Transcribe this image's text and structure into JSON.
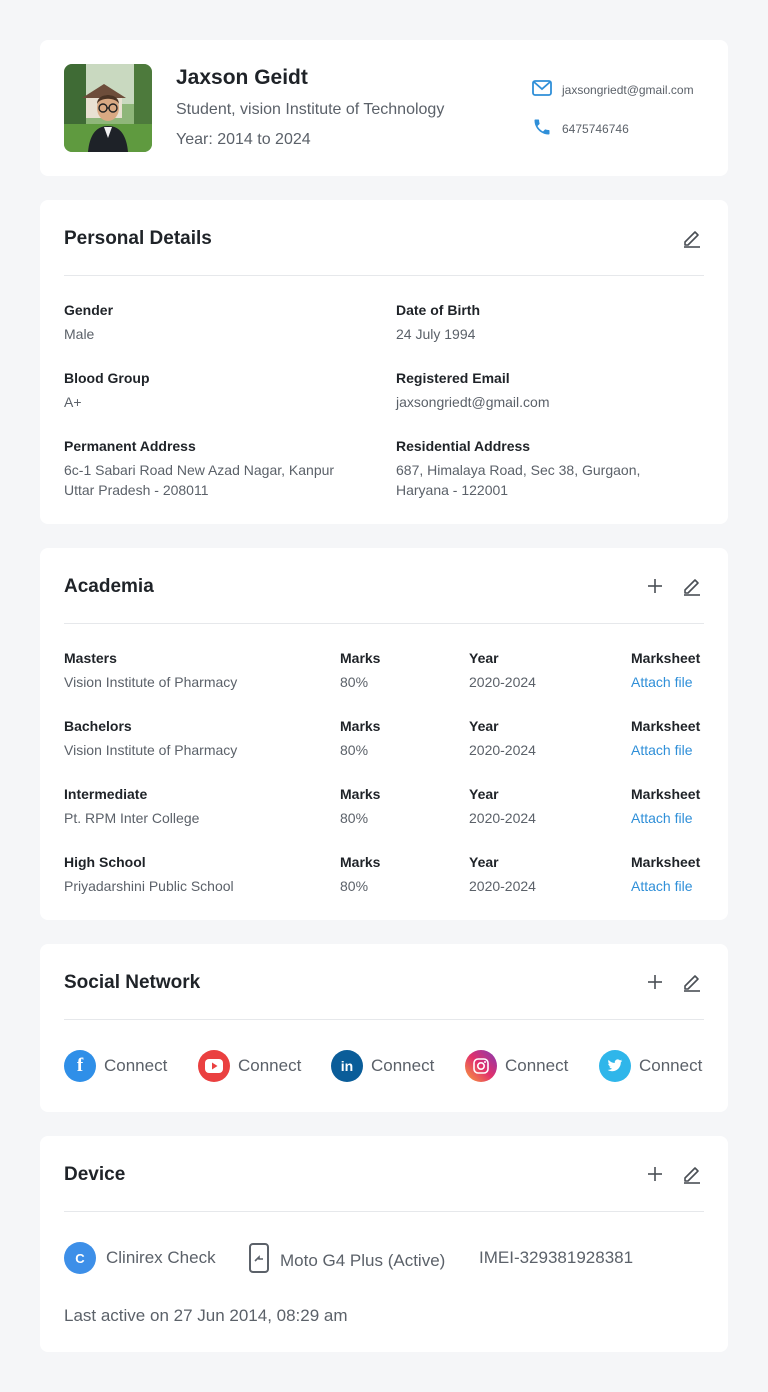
{
  "profile": {
    "name": "Jaxson Geidt",
    "role": "Student, vision Institute of Technology",
    "year": "Year: 2014 to 2024",
    "email": "jaxsongriedt@gmail.com",
    "phone": "6475746746"
  },
  "personal": {
    "title": "Personal Details",
    "fields": [
      {
        "label": "Gender",
        "value": "Male"
      },
      {
        "label": "Date of Birth",
        "value": "24 July 1994"
      },
      {
        "label": "Blood Group",
        "value": "A+"
      },
      {
        "label": "Registered Email",
        "value": "jaxsongriedt@gmail.com"
      },
      {
        "label": "Permanent Address",
        "value": "6c-1 Sabari Road New Azad Nagar, Kanpur",
        "value2": "Uttar Pradesh - 208011"
      },
      {
        "label": "Residential Address",
        "value": "687, Himalaya Road, Sec 38, Gurgaon,",
        "value2": "Haryana - 122001"
      }
    ]
  },
  "academia": {
    "title": "Academia",
    "rows": [
      {
        "level": "Masters",
        "institute": "Vision Institute of Pharmacy",
        "marks_label": "Marks",
        "marks": "80%",
        "year_label": "Year",
        "year": "2020-2024",
        "sheet_label": "Marksheet",
        "attach": "Attach file"
      },
      {
        "level": "Bachelors",
        "institute": "Vision Institute of Pharmacy",
        "marks_label": "Marks",
        "marks": "80%",
        "year_label": "Year",
        "year": "2020-2024",
        "sheet_label": "Marksheet",
        "attach": "Attach file"
      },
      {
        "level": "Intermediate",
        "institute": "Pt. RPM Inter College",
        "marks_label": "Marks",
        "marks": "80%",
        "year_label": "Year",
        "year": "2020-2024",
        "sheet_label": "Marksheet",
        "attach": "Attach file"
      },
      {
        "level": "High School",
        "institute": "Priyadarshini Public School",
        "marks_label": "Marks",
        "marks": "80%",
        "year_label": "Year",
        "year": "2020-2024",
        "sheet_label": "Marksheet",
        "attach": "Attach file"
      }
    ]
  },
  "social": {
    "title": "Social Network",
    "items": [
      {
        "network": "facebook",
        "icon": "facebook-icon",
        "label": "Connect",
        "color": "#2f8fe8"
      },
      {
        "network": "youtube",
        "icon": "youtube-icon",
        "label": "Connect",
        "color": "#ea4040"
      },
      {
        "network": "linkedin",
        "icon": "linkedin-icon",
        "label": "Connect",
        "color": "#0a5d99"
      },
      {
        "network": "instagram",
        "icon": "instagram-icon",
        "label": "Connect",
        "color": "#c13584"
      },
      {
        "network": "twitter",
        "icon": "twitter-icon",
        "label": "Connect",
        "color": "#2fb6ea"
      }
    ]
  },
  "device": {
    "title": "Device",
    "app_initial": "C",
    "app_name": "Clinirex Check",
    "device_name": "Moto G4 Plus (Active)",
    "imei": "IMEI-329381928381",
    "last_active": "Last active on 27 Jun 2014, 08:29 am"
  },
  "colors": {
    "accent": "#2f8fd8",
    "background": "#f5f6f8"
  }
}
